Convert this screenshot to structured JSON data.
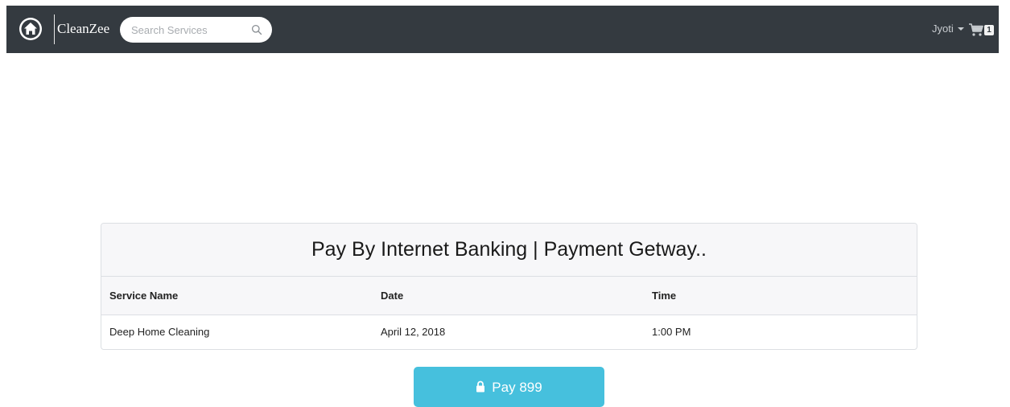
{
  "navbar": {
    "brand": "CleanZee",
    "home_icon": "home-icon",
    "search": {
      "placeholder": "Search Services",
      "value": "",
      "icon": "search-icon"
    },
    "user": {
      "name": "Jyoti",
      "icon": "caret-down-icon"
    },
    "cart": {
      "icon": "cart-icon",
      "count": "1"
    },
    "background_color": "#343a40"
  },
  "payment": {
    "title": "Pay By Internet Banking | Payment Getway..",
    "table": {
      "headers": [
        "Service Name",
        "Date",
        "Time"
      ],
      "rows": [
        [
          "Deep Home Cleaning",
          "April 12, 2018",
          "1:00 PM"
        ]
      ]
    },
    "pay_button": {
      "label": "Pay 899",
      "icon": "lock-icon",
      "color": "#46c0dd"
    }
  }
}
